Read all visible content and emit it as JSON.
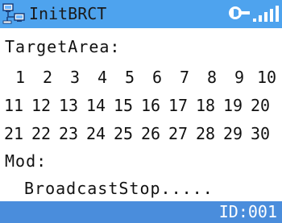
{
  "header": {
    "title": "InitBRCT",
    "icons": [
      "network-computers-icon",
      "plug-connector-icon",
      "signal-strength-icon"
    ],
    "background_color": "#4ea3ee"
  },
  "target_area": {
    "label": "TargetArea:",
    "rows": [
      [
        "1",
        "2",
        "3",
        "4",
        "5",
        "6",
        "7",
        "8",
        "9",
        "10"
      ],
      [
        "11",
        "12",
        "13",
        "14",
        "15",
        "16",
        "17",
        "18",
        "19",
        "20"
      ],
      [
        "21",
        "22",
        "23",
        "24",
        "25",
        "26",
        "27",
        "28",
        "29",
        "30"
      ]
    ]
  },
  "mode": {
    "label": "Mod:",
    "status": "BroadcastStop....."
  },
  "footer": {
    "id_text": "ID:001",
    "background_color": "#4a8ddc"
  }
}
